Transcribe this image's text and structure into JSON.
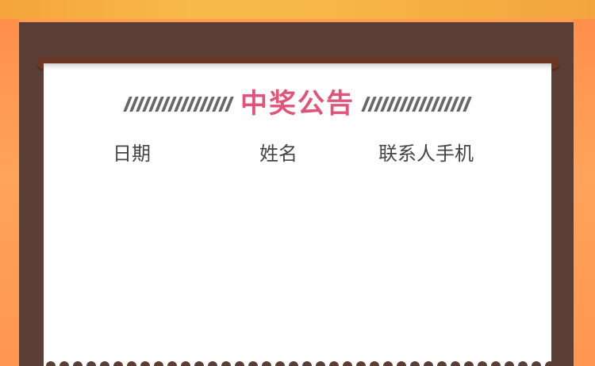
{
  "notice": {
    "title": "中奖公告",
    "columns": [
      "日期",
      "姓名",
      "联系人手机"
    ],
    "rows": []
  },
  "colors": {
    "title": "#e0547a",
    "board": "#5a3d34",
    "rail": "#6a3724",
    "background": "#ff9a52",
    "hatch": "#686868",
    "header_text": "#444444"
  }
}
